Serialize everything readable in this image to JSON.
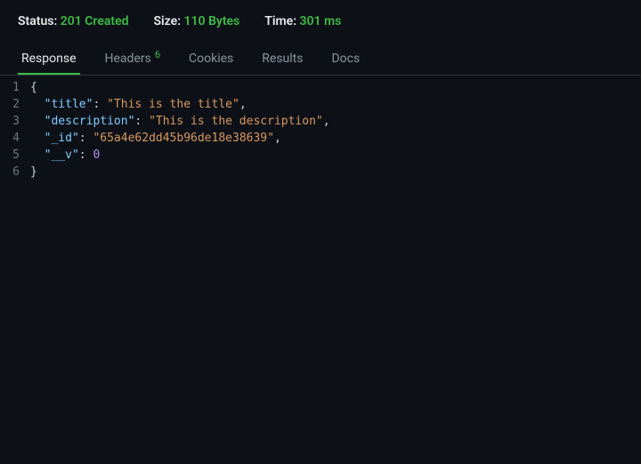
{
  "statusbar": {
    "status_label": "Status:",
    "status_value": "201 Created",
    "size_label": "Size:",
    "size_value": "110 Bytes",
    "time_label": "Time:",
    "time_value": "301 ms"
  },
  "tabs": {
    "response": "Response",
    "headers": "Headers",
    "headers_badge": "6",
    "cookies": "Cookies",
    "results": "Results",
    "docs": "Docs"
  },
  "lines": {
    "l1": "1",
    "l2": "2",
    "l3": "3",
    "l4": "4",
    "l5": "5",
    "l6": "6"
  },
  "json": {
    "open_brace": "{",
    "close_brace": "}",
    "indent": "  ",
    "comma": ",",
    "colon": ": ",
    "title_key": "\"title\"",
    "title_val": "\"This is the title\"",
    "description_key": "\"description\"",
    "description_val": "\"This is the description\"",
    "id_key": "\"_id\"",
    "id_val": "\"65a4e62dd45b96de18e38639\"",
    "v_key": "\"__v\"",
    "v_val": "0"
  }
}
